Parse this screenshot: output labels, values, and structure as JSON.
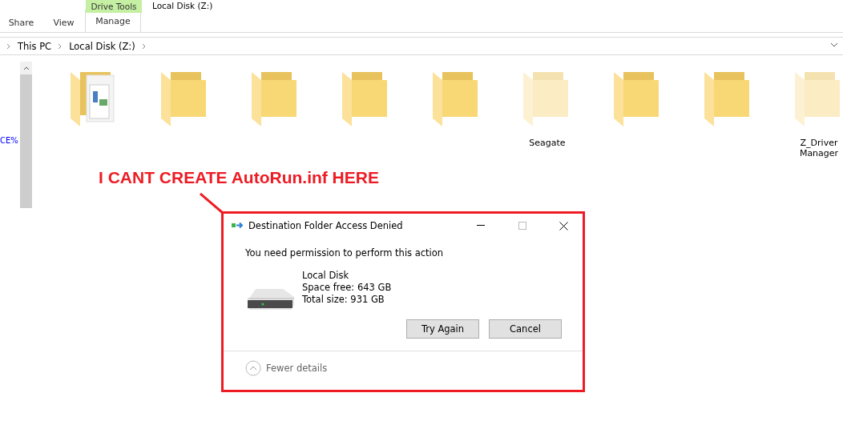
{
  "ribbon": {
    "context_group": "Drive Tools",
    "window_title": "Local Disk (Z:)",
    "tabs": [
      {
        "label": "Share",
        "selected": false
      },
      {
        "label": "View",
        "selected": false
      },
      {
        "label": "Manage",
        "selected": true
      }
    ]
  },
  "address_bar": {
    "crumbs": [
      "This PC",
      "Local Disk (Z:)"
    ]
  },
  "navigation_pane": {
    "text": "CE%"
  },
  "folders": [
    {
      "kind": "documents",
      "hidden": false
    },
    {
      "kind": "plain",
      "hidden": false
    },
    {
      "kind": "plain",
      "hidden": false
    },
    {
      "kind": "plain",
      "hidden": false
    },
    {
      "kind": "plain",
      "hidden": false
    },
    {
      "kind": "plain",
      "hidden": true,
      "name": "Seagate"
    },
    {
      "kind": "plain",
      "hidden": false
    },
    {
      "kind": "plain",
      "hidden": false
    },
    {
      "kind": "plain",
      "hidden": true,
      "name": "Z_Driver Manager"
    }
  ],
  "annotation": {
    "text": "I CANT CREATE AutoRun.inf HERE"
  },
  "dialog": {
    "title": "Destination Folder Access Denied",
    "message": "You need permission to perform this action",
    "drive": {
      "name": "Local Disk",
      "space_free": "Space free: 643 GB",
      "total_size": "Total size: 931 GB"
    },
    "buttons": [
      "Try Again",
      "Cancel"
    ],
    "details_toggle": "Fewer details"
  }
}
